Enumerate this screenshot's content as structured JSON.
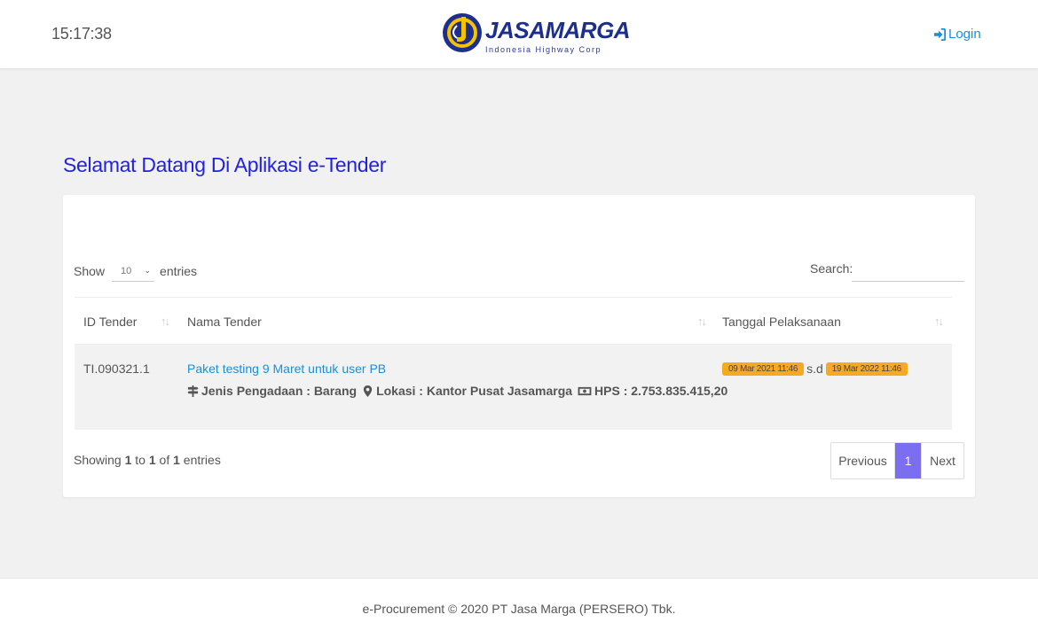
{
  "header": {
    "clock": "15:17:38",
    "logo_name": "JASAMARGA",
    "logo_tagline": "Indonesia Highway Corp",
    "login_label": "Login"
  },
  "welcome_title": "Selamat Datang Di Aplikasi e-Tender",
  "table_controls": {
    "show_label": "Show",
    "entries_value": "10",
    "entries_label": "entries",
    "search_label": "Search:",
    "search_value": ""
  },
  "columns": [
    "ID Tender",
    "Nama Tender",
    "Tanggal Pelaksanaan"
  ],
  "rows": [
    {
      "id": "TI.090321.1",
      "name": "Paket testing 9 Maret untuk user PB",
      "jenis": "Jenis Pengadaan : Barang",
      "lokasi": "Lokasi : Kantor Pusat Jasamarga",
      "hps": "HPS : 2.753.835.415,20",
      "start": "09 Mar 2021 11:46",
      "sd": "s.d",
      "end": "19 Mar 2022 11:46"
    }
  ],
  "info": {
    "prefix": "Showing ",
    "from": "1",
    "to_word": " to ",
    "to": "1",
    "of_word": " of ",
    "total": "1",
    "suffix": " entries"
  },
  "pagination": {
    "previous": "Previous",
    "current": "1",
    "next": "Next"
  },
  "footer": "e-Procurement © 2020 PT Jasa Marga (PERSERO) Tbk.",
  "colors": {
    "accent": "#1a8fd8",
    "title": "#2222dd",
    "badge": "#f7a924",
    "page_active": "#7b6ef0",
    "logo_blue": "#1c2f8c",
    "logo_yellow": "#f6c200"
  }
}
